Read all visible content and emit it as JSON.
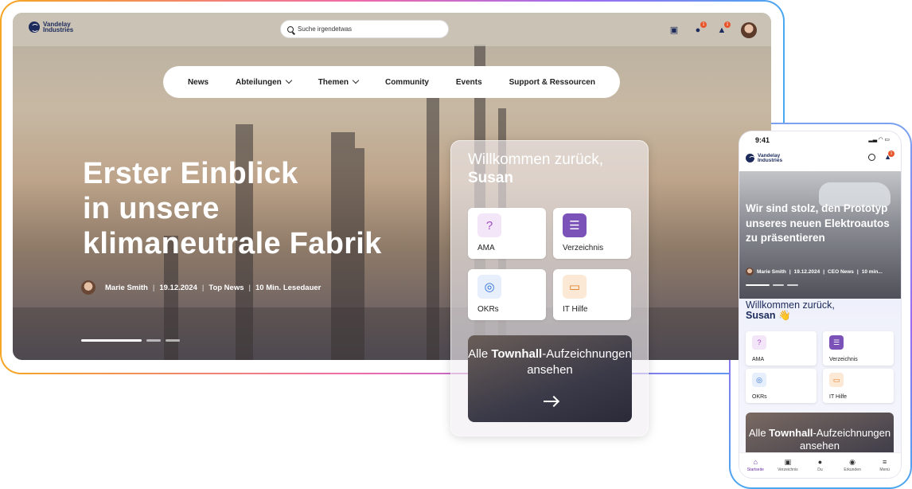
{
  "brand": {
    "name_line1": "Vandelay",
    "name_line2": "Industries"
  },
  "colors": {
    "brand_navy": "#1d2b5c",
    "badge": "#e8552b",
    "accent_purple": "#6b2fa3"
  },
  "search": {
    "placeholder": "Suche irgendetwas"
  },
  "topbar": {
    "icons": [
      "directory-icon",
      "chat-icon",
      "bell-icon",
      "avatar"
    ],
    "chat_badge": "1",
    "bell_badge": "1"
  },
  "nav": {
    "items": [
      {
        "label": "News"
      },
      {
        "label": "Abteilungen",
        "has_dropdown": true
      },
      {
        "label": "Themen",
        "has_dropdown": true
      },
      {
        "label": "Community"
      },
      {
        "label": "Events"
      },
      {
        "label": "Support & Ressourcen"
      }
    ]
  },
  "hero": {
    "title_line1": "Erster Einblick",
    "title_line2": "in unsere",
    "title_line3": "klimaneutrale Fabrik",
    "author": "Marie Smith",
    "date": "19.12.2024",
    "category": "Top News",
    "read_time": "10 Min. Lesedauer"
  },
  "welcome": {
    "greeting": "Willkommen zurück,",
    "name": "Susan",
    "tiles": [
      {
        "label": "AMA",
        "icon": "question-bubble-icon",
        "color": "#f3e6f8"
      },
      {
        "label": "Verzeichnis",
        "icon": "address-book-icon",
        "color": "#7b52b8"
      },
      {
        "label": "OKRs",
        "icon": "target-cursor-icon",
        "color": "#e6effb"
      },
      {
        "label": "IT Hilfe",
        "icon": "monitor-icon",
        "color": "#fbe9d6"
      }
    ],
    "townhall_pre": "Alle ",
    "townhall_bold": "Townhall",
    "townhall_rest": "-Aufzeichnungen ansehen"
  },
  "mobile": {
    "time": "9:41",
    "hero_title": "Wir sind stolz, den Prototyp unseres neuen Elektroautos zu präsentieren",
    "author": "Marie Smith",
    "date": "19.12.2024",
    "category": "CEO News",
    "read_time": "10 min...",
    "greeting": "Willkommen zurück,",
    "name": "Susan",
    "wave": "👋",
    "townhall_pre": "Alle ",
    "townhall_bold": "Townhall",
    "townhall_rest": "-Aufzeichnungen ansehen",
    "tabs": [
      {
        "label": "Startseite",
        "icon": "home-icon",
        "active": true
      },
      {
        "label": "Verzeichnis",
        "icon": "directory-icon"
      },
      {
        "label": "Du",
        "icon": "avatar"
      },
      {
        "label": "Erkunden",
        "icon": "compass-icon"
      },
      {
        "label": "Menü",
        "icon": "menu-icon"
      }
    ]
  }
}
